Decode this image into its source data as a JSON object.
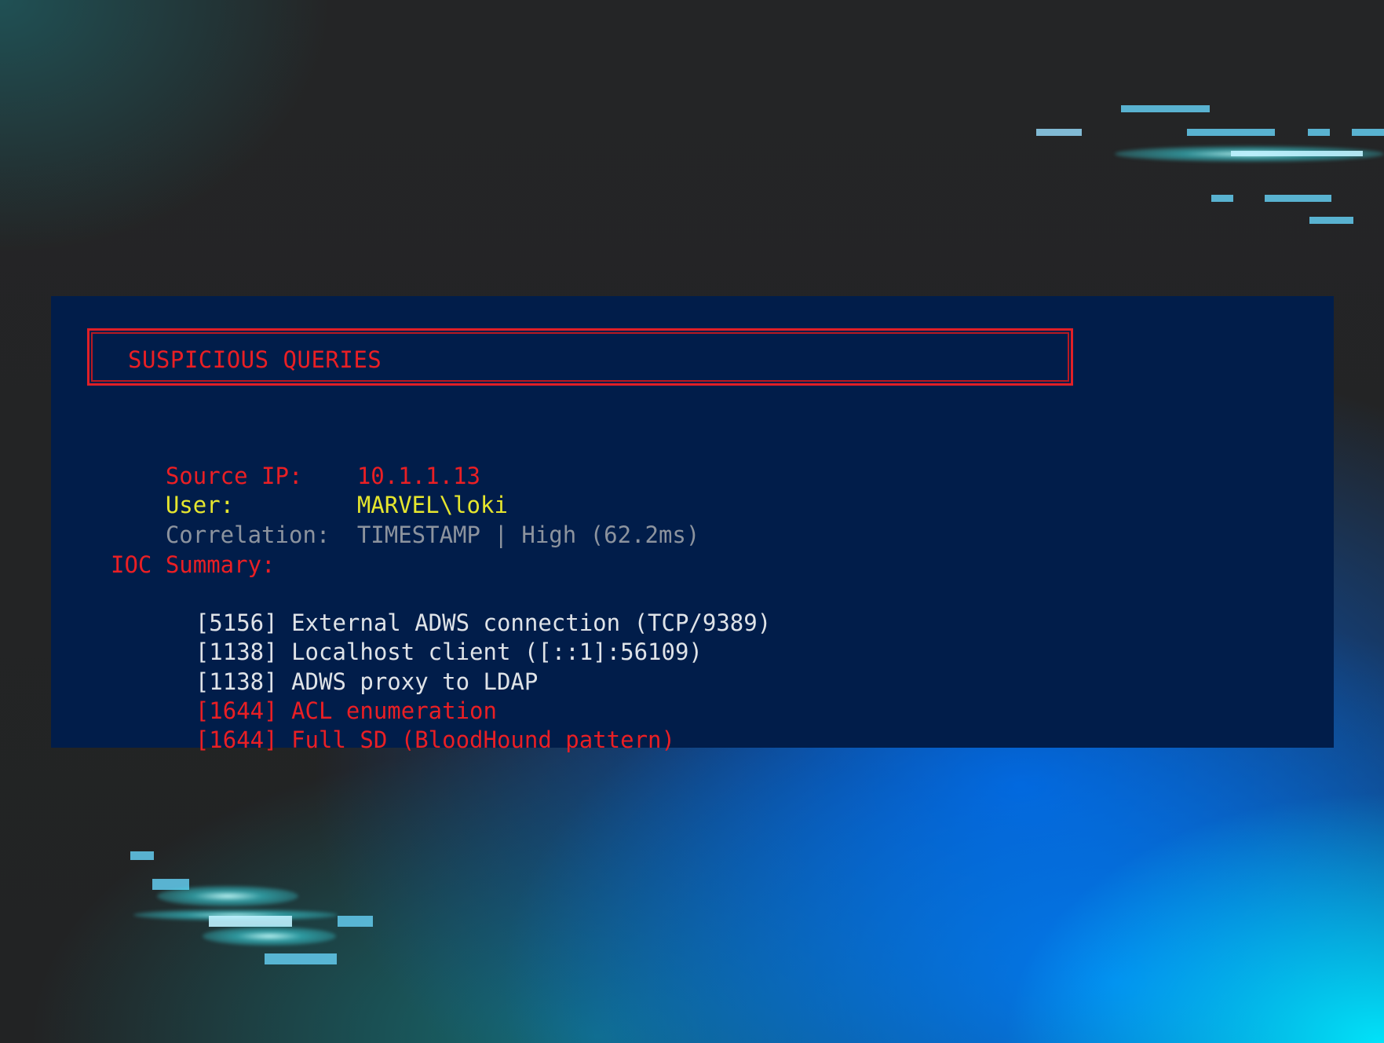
{
  "panel": {
    "title": "SUSPICIOUS QUERIES",
    "source_ip": {
      "label": "Source IP:",
      "value": "10.1.1.13"
    },
    "user": {
      "label": "User:",
      "value": "MARVEL\\loki"
    },
    "correlation": {
      "label": "Correlation:",
      "value": "TIMESTAMP | High (62.2ms)"
    },
    "ioc": {
      "heading": "IOC Summary:",
      "items": [
        {
          "id": "[5156]",
          "text": "External ADWS connection (TCP/9389)",
          "severity": "normal"
        },
        {
          "id": "[1138]",
          "text": "Localhost client ([::1]:56109)",
          "severity": "normal"
        },
        {
          "id": "[1138]",
          "text": "ADWS proxy to LDAP",
          "severity": "normal"
        },
        {
          "id": "[1644]",
          "text": "ACL enumeration",
          "severity": "alert"
        },
        {
          "id": "[1644]",
          "text": "Full SD (BloodHound pattern)",
          "severity": "alert"
        }
      ]
    }
  },
  "colors": {
    "panel_bg": "#011d4a",
    "alert_red": "#ea1f24",
    "user_yellow": "#e6e62e",
    "muted_gray": "#8c939e",
    "normal_text": "#dfe3e8",
    "accent_cyan": "#5fc2e3"
  }
}
